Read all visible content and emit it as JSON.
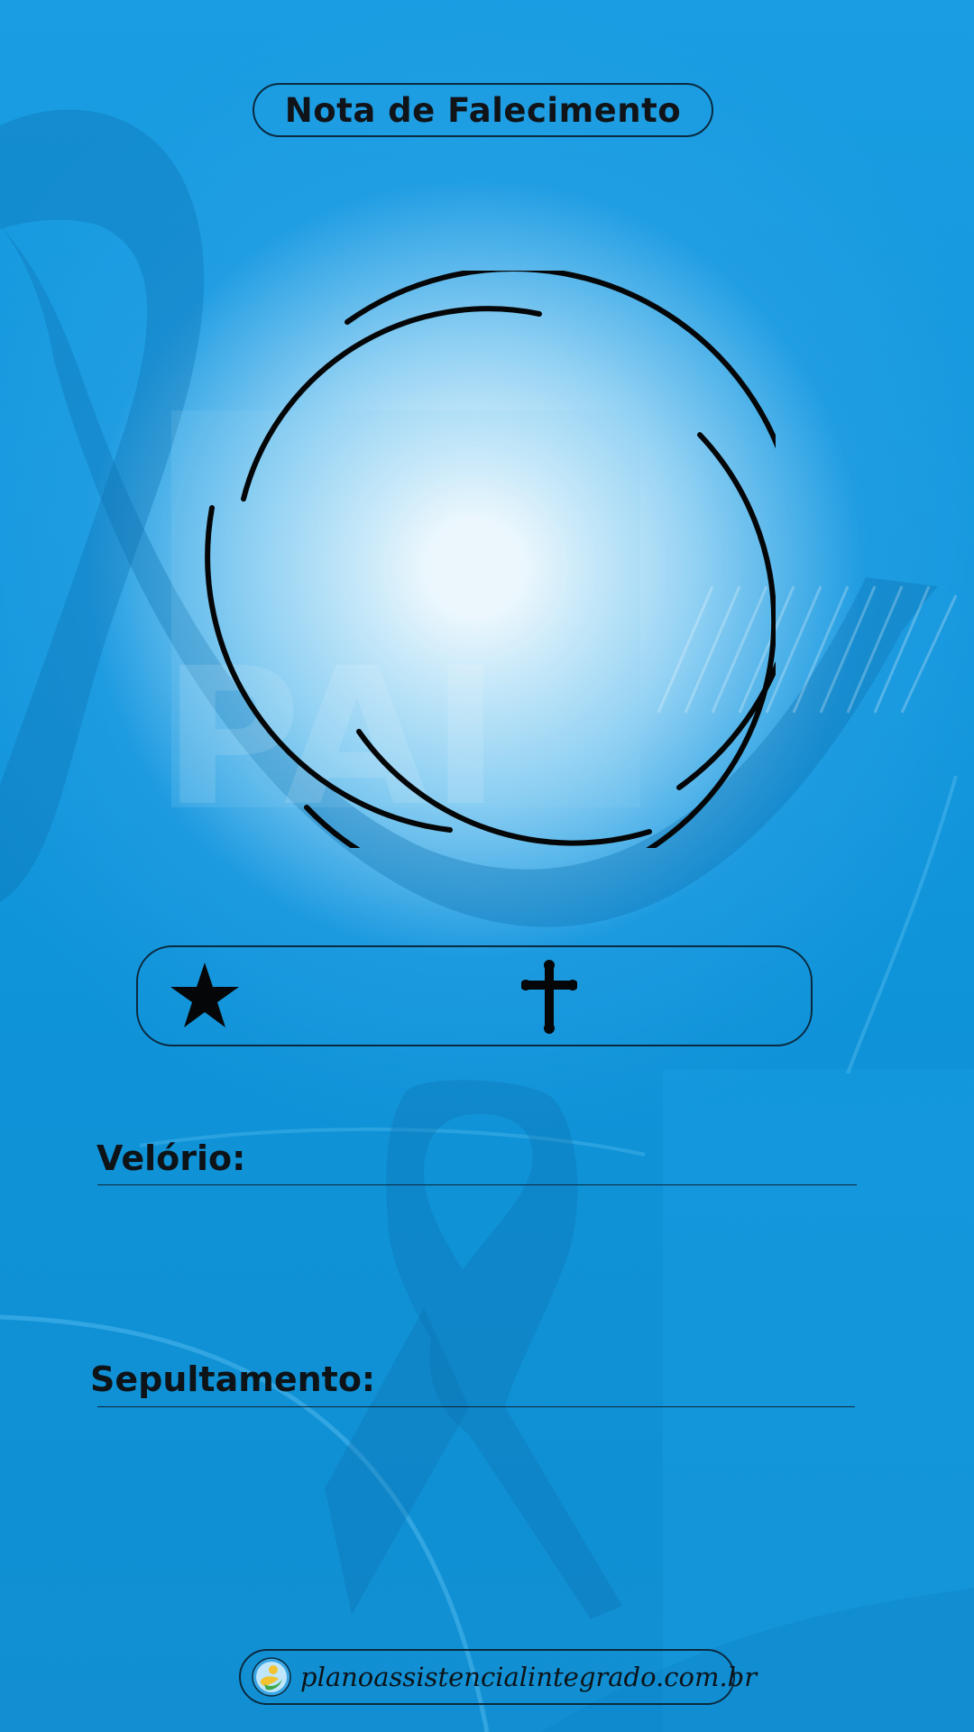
{
  "header": {
    "title": "Nota de Falecimento"
  },
  "photo_frame": {
    "icon": "photo-placeholder-ring"
  },
  "dates_bar": {
    "birth_icon": "star-icon",
    "death_icon": "cross-icon"
  },
  "fields": {
    "wake_label": "Velório:",
    "burial_label": "Sepultamento:"
  },
  "footer": {
    "website": "planoassistencialintegrado.com.br",
    "logo_icon": "brand-logo-icon"
  },
  "colors": {
    "background": "#1296dc",
    "ribbon": "#0b72b3",
    "ink": "#0d1317",
    "glow": "#ffffff"
  }
}
